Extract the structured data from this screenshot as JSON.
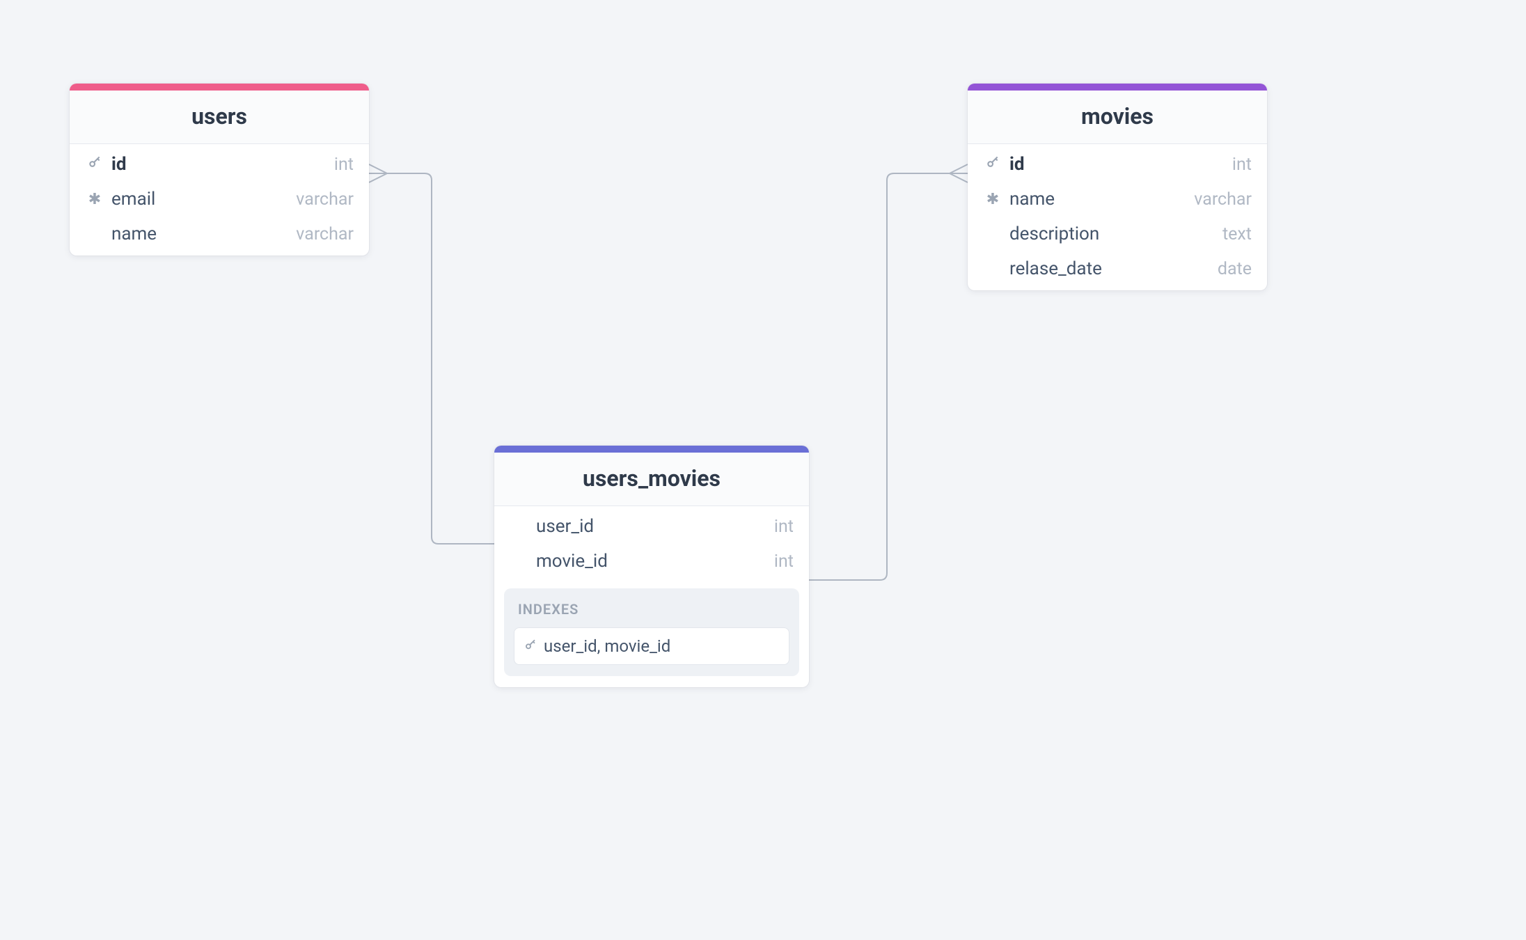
{
  "colors": {
    "users_accent": "#ef5d8a",
    "movies_accent": "#9354d6",
    "users_movies_accent": "#6a6fd6"
  },
  "tables": {
    "users": {
      "title": "users",
      "columns": [
        {
          "icon": "key",
          "name": "id",
          "type": "int",
          "bold": true
        },
        {
          "icon": "snow",
          "name": "email",
          "type": "varchar",
          "bold": false
        },
        {
          "icon": "",
          "name": "name",
          "type": "varchar",
          "bold": false
        }
      ]
    },
    "movies": {
      "title": "movies",
      "columns": [
        {
          "icon": "key",
          "name": "id",
          "type": "int",
          "bold": true
        },
        {
          "icon": "snow",
          "name": "name",
          "type": "varchar",
          "bold": false
        },
        {
          "icon": "",
          "name": "description",
          "type": "text",
          "bold": false
        },
        {
          "icon": "",
          "name": "relase_date",
          "type": "date",
          "bold": false
        }
      ]
    },
    "users_movies": {
      "title": "users_movies",
      "columns": [
        {
          "icon": "",
          "name": "user_id",
          "type": "int",
          "bold": false
        },
        {
          "icon": "",
          "name": "movie_id",
          "type": "int",
          "bold": false
        }
      ],
      "indexes_label": "INDEXES",
      "indexes": [
        {
          "icon": "key",
          "text": "user_id, movie_id"
        }
      ]
    }
  },
  "relationships": [
    {
      "from": "users.id",
      "to": "users_movies.user_id",
      "crowfoot_at": "from_end"
    },
    {
      "from": "movies.id",
      "to": "users_movies.movie_id",
      "crowfoot_at": "from_end"
    }
  ]
}
